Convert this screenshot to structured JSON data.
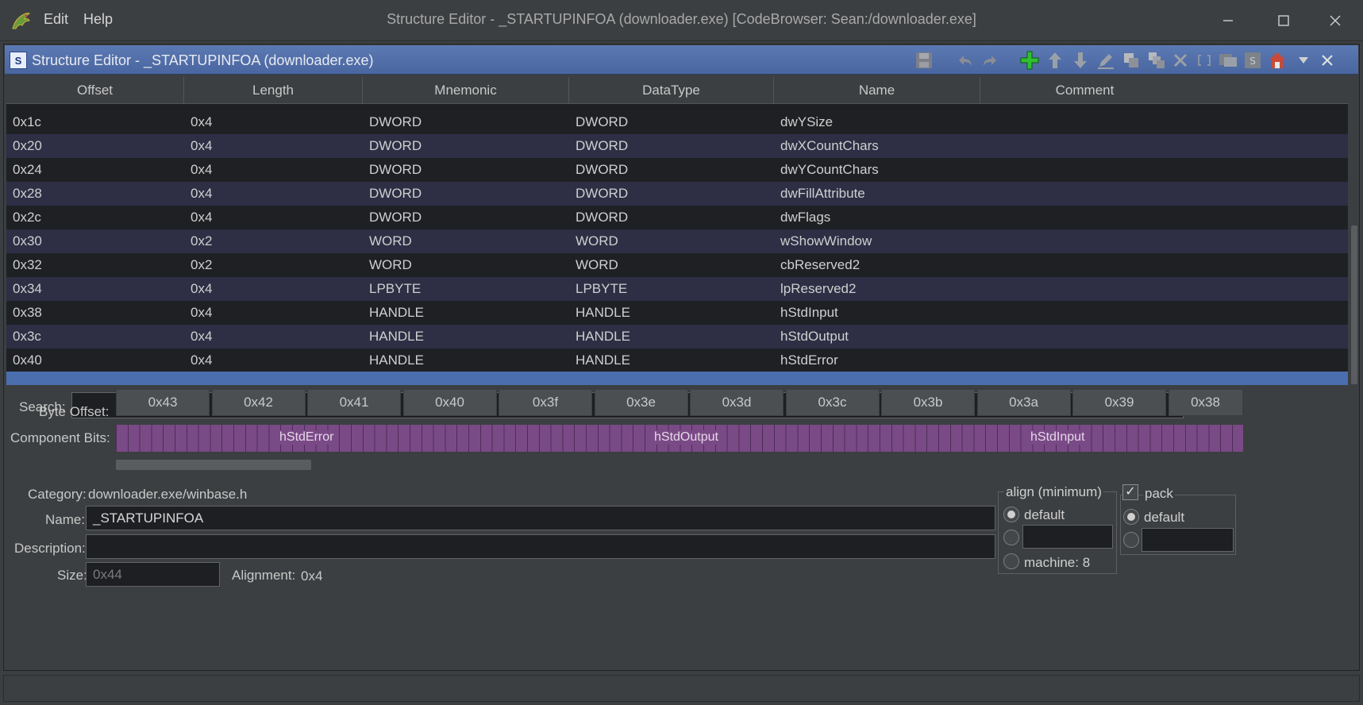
{
  "window": {
    "title": "Structure Editor - _STARTUPINFOA (downloader.exe) [CodeBrowser: Sean:/downloader.exe]",
    "menu": [
      "Edit",
      "Help"
    ],
    "controls": [
      "minimize-icon",
      "maximize-icon",
      "close-icon"
    ]
  },
  "panel": {
    "title": "Structure Editor - _STARTUPINFOA (downloader.exe)",
    "icon_letter": "S",
    "toolbar_icons": [
      "save-icon",
      "undo-icon",
      "redo-icon",
      "add-icon",
      "move-up-icon",
      "move-down-icon",
      "edit-icon",
      "duplicate-icon",
      "duplicate-multiple-icon",
      "delete-icon",
      "array-icon",
      "create-struct-icon",
      "unpackage-icon",
      "show-in-datatype-manager-icon",
      "menu-dropdown-icon",
      "close-panel-icon"
    ]
  },
  "table": {
    "columns": [
      "Offset",
      "Length",
      "Mnemonic",
      "DataType",
      "Name",
      "Comment"
    ],
    "rows": [
      {
        "offset": "0x1c",
        "length": "0x4",
        "mnemonic": "DWORD",
        "datatype": "DWORD",
        "name": "dwYSize",
        "comment": ""
      },
      {
        "offset": "0x20",
        "length": "0x4",
        "mnemonic": "DWORD",
        "datatype": "DWORD",
        "name": "dwXCountChars",
        "comment": ""
      },
      {
        "offset": "0x24",
        "length": "0x4",
        "mnemonic": "DWORD",
        "datatype": "DWORD",
        "name": "dwYCountChars",
        "comment": ""
      },
      {
        "offset": "0x28",
        "length": "0x4",
        "mnemonic": "DWORD",
        "datatype": "DWORD",
        "name": "dwFillAttribute",
        "comment": ""
      },
      {
        "offset": "0x2c",
        "length": "0x4",
        "mnemonic": "DWORD",
        "datatype": "DWORD",
        "name": "dwFlags",
        "comment": ""
      },
      {
        "offset": "0x30",
        "length": "0x2",
        "mnemonic": "WORD",
        "datatype": "WORD",
        "name": "wShowWindow",
        "comment": ""
      },
      {
        "offset": "0x32",
        "length": "0x2",
        "mnemonic": "WORD",
        "datatype": "WORD",
        "name": "cbReserved2",
        "comment": ""
      },
      {
        "offset": "0x34",
        "length": "0x4",
        "mnemonic": "LPBYTE",
        "datatype": "LPBYTE",
        "name": "lpReserved2",
        "comment": ""
      },
      {
        "offset": "0x38",
        "length": "0x4",
        "mnemonic": "HANDLE",
        "datatype": "HANDLE",
        "name": "hStdInput",
        "comment": ""
      },
      {
        "offset": "0x3c",
        "length": "0x4",
        "mnemonic": "HANDLE",
        "datatype": "HANDLE",
        "name": "hStdOutput",
        "comment": ""
      },
      {
        "offset": "0x40",
        "length": "0x4",
        "mnemonic": "HANDLE",
        "datatype": "HANDLE",
        "name": "hStdError",
        "comment": ""
      }
    ]
  },
  "search": {
    "label": "Search:",
    "value": ""
  },
  "bit_editor": {
    "byte_offset_label": "Byte Offset:",
    "component_bits_label": "Component Bits:",
    "byte_offsets": [
      "0x43",
      "0x42",
      "0x41",
      "0x40",
      "0x3f",
      "0x3e",
      "0x3d",
      "0x3c",
      "0x3b",
      "0x3a",
      "0x39",
      "0x38"
    ],
    "components": [
      "hStdError",
      "hStdOutput",
      "hStdInput"
    ]
  },
  "properties": {
    "category_label": "Category:",
    "category_value": "downloader.exe/winbase.h",
    "name_label": "Name:",
    "name_value": "_STARTUPINFOA",
    "description_label": "Description:",
    "description_value": "",
    "size_label": "Size:",
    "size_placeholder": "0x44",
    "alignment_label": "Alignment:",
    "alignment_value": "0x4"
  },
  "align": {
    "title": "align (minimum)",
    "default_label": "default",
    "custom_value": "",
    "machine_label": "machine: 8",
    "selected": "default"
  },
  "pack": {
    "label": "pack",
    "checked": true,
    "default_label": "default",
    "custom_value": "",
    "selected": "default"
  },
  "colors": {
    "accent": "#4b6eaf",
    "component_bits": "#7a4a86",
    "add_icon": "#2fbf2f"
  }
}
